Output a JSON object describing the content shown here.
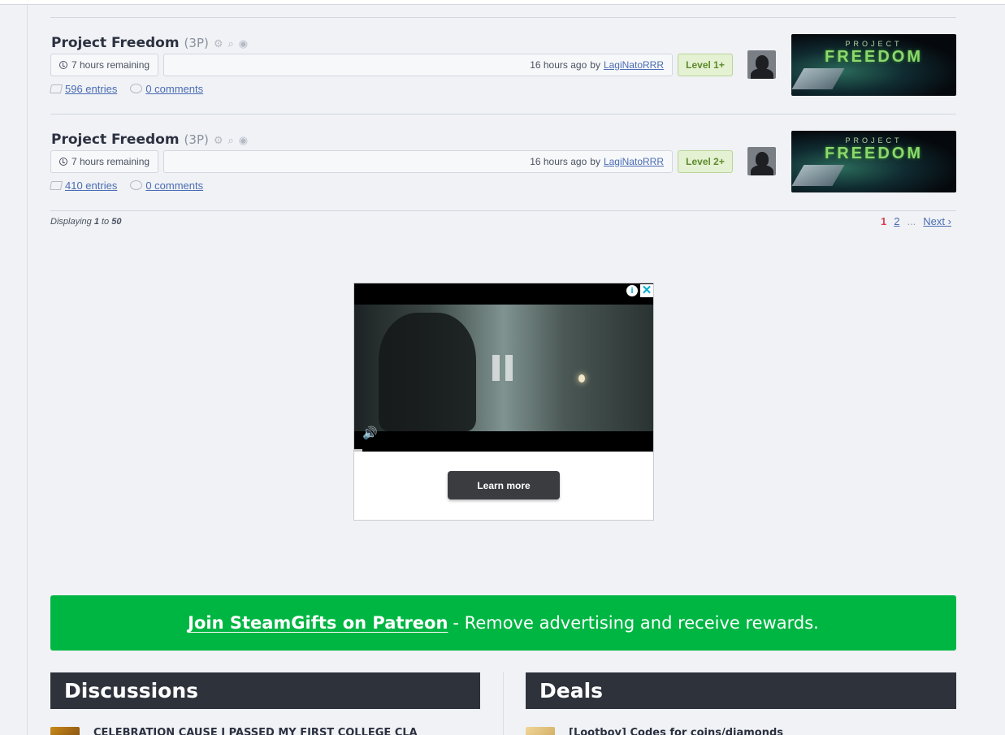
{
  "giveaways": [
    {
      "name": "Project Freedom",
      "copies": "(3P)",
      "time_remaining": "7 hours remaining",
      "created": "16 hours ago",
      "by": "by",
      "creator": "LagiNatoRRR",
      "level": "Level 1+",
      "entries": "596 entries",
      "comments": "0 comments",
      "thumb_top": "PROJECT",
      "thumb_title": "FREEDOM"
    },
    {
      "name": "Project Freedom",
      "copies": "(3P)",
      "time_remaining": "7 hours remaining",
      "created": "16 hours ago",
      "by": "by",
      "creator": "LagiNatoRRR",
      "level": "Level 2+",
      "entries": "410 entries",
      "comments": "0 comments",
      "thumb_top": "PROJECT",
      "thumb_title": "FREEDOM"
    }
  ],
  "paginator": {
    "displaying": "Displaying",
    "from": "1",
    "to_word": "to",
    "to": "50",
    "current": "1",
    "page2": "2",
    "dots": "...",
    "next": "Next"
  },
  "ad": {
    "info": "i",
    "close": "✕",
    "learn_more": "Learn more"
  },
  "patreon": {
    "strong": "Join SteamGifts on Patreon",
    "rest": "- Remove advertising and receive rewards."
  },
  "discussions": {
    "heading": "Discussions",
    "first_item": "CELEBRATION CAUSE I PASSED MY FIRST COLLEGE CLA"
  },
  "deals": {
    "heading": "Deals",
    "first_item": "[Lootboy] Codes for coins/diamonds"
  },
  "colors": {
    "patreon_green": "#00b643",
    "header_dark": "#2e323b",
    "link_blue": "#4a6cb3",
    "level_green": "#5d8a2c",
    "current_page_red": "#d93f55"
  }
}
